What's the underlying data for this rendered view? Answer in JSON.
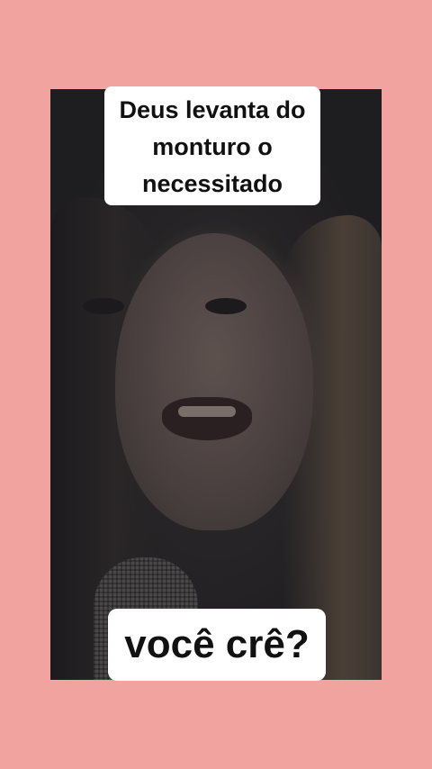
{
  "captions": {
    "top_lines": [
      "Deus levanta do",
      "monturo o",
      "necessitado"
    ],
    "bottom": "você crê?"
  },
  "colors": {
    "background": "#f1a3a0",
    "caption_bg": "#ffffff",
    "caption_text": "#111111"
  }
}
